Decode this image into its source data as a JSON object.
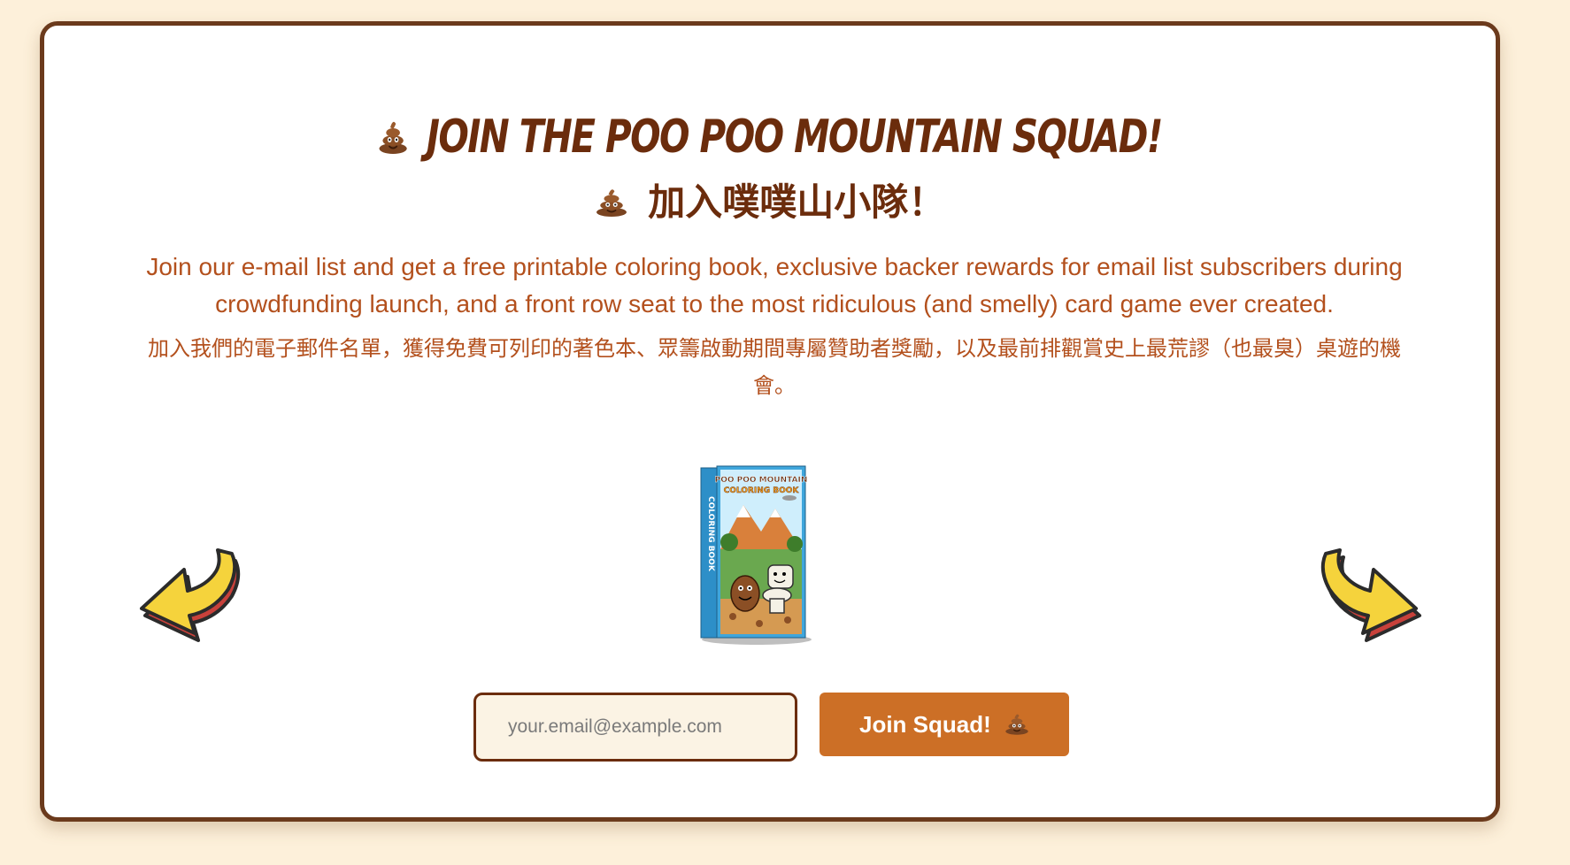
{
  "signup": {
    "title_en": "Join the Poo Poo Mountain Squad!",
    "title_zh": "加入噗噗山小隊！",
    "description_en": "Join our e-mail list and get a free printable coloring book, exclusive backer rewards for email list subscribers during crowdfunding launch, and a front row seat to the most ridiculous (and smelly) card game ever created.",
    "description_zh": "加入我們的電子郵件名單，獲得免費可列印的著色本、眾籌啟動期間專屬贊助者獎勵，以及最前排觀賞史上最荒謬（也最臭）桌遊的機會。",
    "email_placeholder": "your.email@example.com",
    "email_value": "",
    "button_label": "Join Squad!",
    "book_cover": {
      "title_line1": "POO POO MOUNTAIN",
      "title_line2": "COLORING BOOK",
      "spine_text": "COLORING BOOK"
    }
  },
  "icons": {
    "title_icon": "poo-emoji-icon",
    "button_icon": "poo-emoji-icon",
    "left_arrow": "curved-arrow-down-left-icon",
    "right_arrow": "curved-arrow-down-right-icon"
  },
  "colors": {
    "page_background": "#fdf0da",
    "card_border": "#6b3a1c",
    "title": "#6b2c0c",
    "description": "#b3501d",
    "button": "#cc6f26",
    "input_background": "#fbf3e4"
  }
}
